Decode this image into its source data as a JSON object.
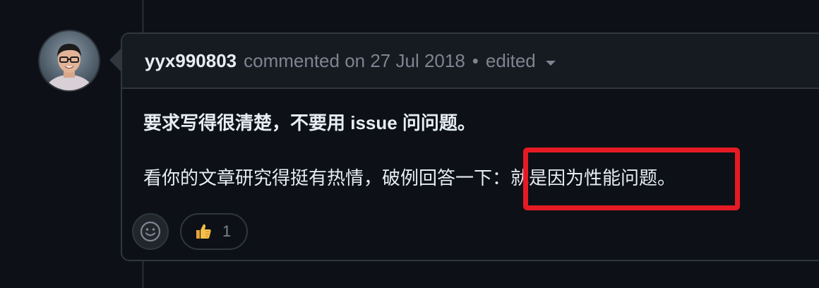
{
  "comment": {
    "author": "yyx990803",
    "action_text": "commented on 27 Jul 2018",
    "separator": "•",
    "edited_label": "edited",
    "paragraphs": [
      "要求写得很清楚，不要用 issue 问问题。",
      "看你的文章研究得挺有热情，破例回答一下：就是因为性能问题。"
    ],
    "reactions": [
      {
        "emoji": "thumbs-up-icon",
        "count": "1"
      }
    ]
  },
  "colors": {
    "background": "#0d1117",
    "header_background": "#161b22",
    "border": "#30363d",
    "text_primary": "#e6edf3",
    "text_muted": "#7d8590",
    "annotation_red": "#e61a24"
  }
}
